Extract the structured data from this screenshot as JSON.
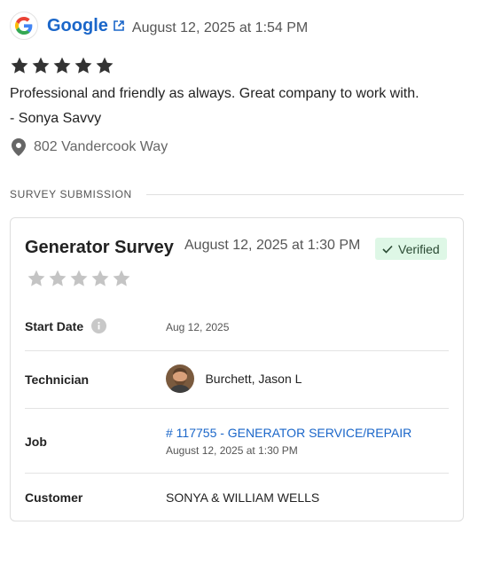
{
  "review": {
    "source": "Google",
    "source_icon": "google-g-logo",
    "date": "August 12, 2025 at 1:54 PM",
    "rating": 5,
    "rating_max": 5,
    "text": "Professional and friendly as always. Great company to work with.",
    "author": "- Sonya Savvy",
    "location": "802 Vandercook Way"
  },
  "section": {
    "label": "SURVEY SUBMISSION"
  },
  "survey": {
    "title": "Generator Survey",
    "date": "August 12, 2025 at 1:30 PM",
    "badge": "Verified",
    "rating": 0,
    "rating_max": 5,
    "rows": {
      "start_date": {
        "label": "Start Date",
        "value": "Aug 12, 2025"
      },
      "technician": {
        "label": "Technician",
        "value": "Burchett, Jason L"
      },
      "job": {
        "label": "Job",
        "link": "# 117755 - GENERATOR SERVICE/REPAIR",
        "date": "August 12, 2025 at 1:30 PM"
      },
      "customer": {
        "label": "Customer",
        "value": "SONYA & WILLIAM WELLS"
      }
    }
  },
  "colors": {
    "link": "#1a66c9",
    "star_filled": "#333333",
    "star_empty": "#c4c4c4",
    "verified_bg": "#def7e6"
  }
}
